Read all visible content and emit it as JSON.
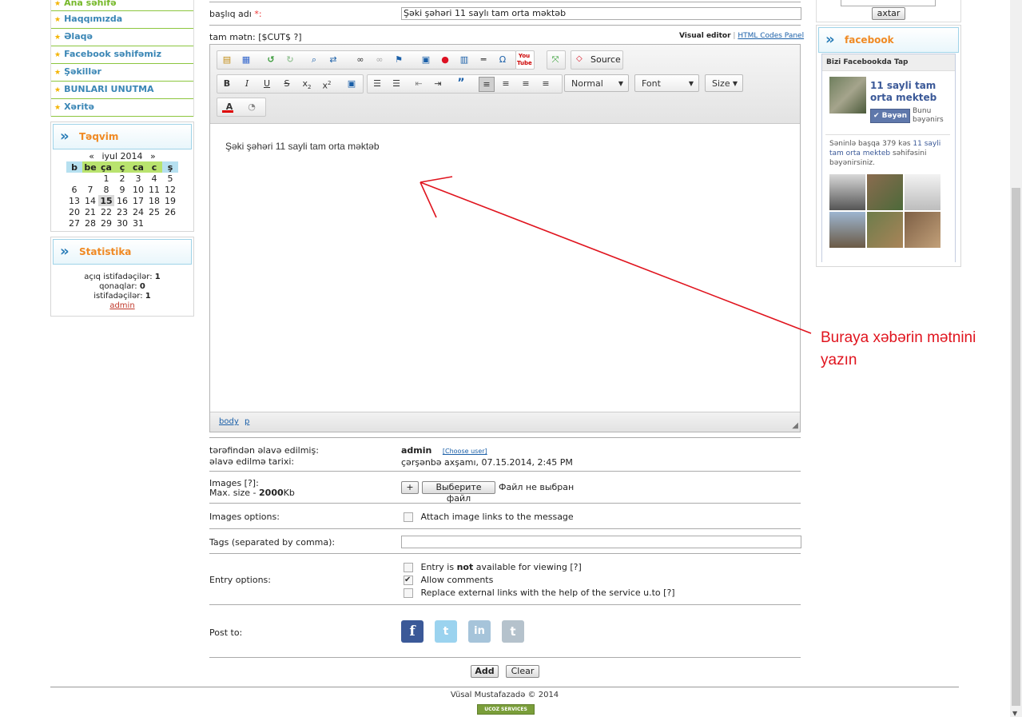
{
  "menu": {
    "items": [
      "Ana səhifə",
      "Haqqımızda",
      "Əlaqə",
      "Facebook səhifəmiz",
      "Şəkillər",
      "BUNLARI UNUTMA",
      "Xəritə"
    ]
  },
  "calendar": {
    "title": "Təqvim",
    "nav_prev": "«",
    "month": "iyul 2014",
    "nav_next": "»",
    "weekdays": [
      "b",
      "be",
      "ça",
      "ç",
      "ca",
      "c",
      "ş"
    ],
    "weeks": [
      [
        "",
        "",
        "1",
        "2",
        "3",
        "4",
        "5"
      ],
      [
        "6",
        "7",
        "8",
        "9",
        "10",
        "11",
        "12"
      ],
      [
        "13",
        "14",
        "15",
        "16",
        "17",
        "18",
        "19"
      ],
      [
        "20",
        "21",
        "22",
        "23",
        "24",
        "25",
        "26"
      ],
      [
        "27",
        "28",
        "29",
        "30",
        "31",
        "",
        ""
      ]
    ],
    "today": "15"
  },
  "stats": {
    "title": "Statistika",
    "online_label": "açıq istifadəçilər:",
    "online_value": "1",
    "guests_label": "qonaqlar:",
    "guests_value": "0",
    "users_label": "istifadəçilər:",
    "users_value": "1",
    "user_link": "admin"
  },
  "search": {
    "button": "axtar"
  },
  "form": {
    "title_label": "başlıq adı",
    "required_mark": "*:",
    "title_value": "Şəki şəhəri 11 saylı tam orta məktəb",
    "body_label": "tam mətn: [$CUT$ ?]",
    "visual_editor": "Visual editor",
    "separator": "|",
    "html_codes": "HTML Codes Panel",
    "editor_content": "Şəki şəhəri 11 sayli tam orta məktəb",
    "path_body": "body",
    "path_p": "p",
    "added_by_label": "tərəfindən əlavə edilmiş:",
    "added_by_value": "admin",
    "choose_user": "[Choose user]",
    "date_label": "əlavə edilmə tarixi:",
    "date_value": "çərşənbə axşamı, 07.15.2014, 2:45 PM",
    "images_label": "Images [?]:",
    "max_size_prefix": "Max. size - ",
    "max_size_value": "2000",
    "max_size_unit": "Kb",
    "plus": "+",
    "choose_file": "Выберите файл",
    "no_file": "Файл не выбран",
    "images_options_label": "Images options:",
    "attach_links": "Attach image links to the message",
    "tags_label": "Tags (separated by comma):",
    "entry_options_label": "Entry options:",
    "opt1_a": "Entry is",
    "opt1_b": "not",
    "opt1_c": "available for viewing [?]",
    "opt2": "Allow comments",
    "opt3": "Replace external links with the help of the service u.to [?]",
    "post_to_label": "Post to:",
    "add_button": "Add",
    "clear_button": "Clear"
  },
  "toolbar": {
    "source": "Source",
    "format": "Normal",
    "font": "Font",
    "size": "Size"
  },
  "annotation": {
    "line1": "Buraya xəbərin mətnini",
    "line2": "yazın",
    "color": "#e0141e"
  },
  "facebook": {
    "title": "facebook",
    "box_title": "Bizi Facebookda Tap",
    "page_name": "11 sayli tam orta mekteb",
    "like_button": "Bəyən",
    "like_text": "Bunu bəyənirs",
    "friends_text_a": "Səninlə başqa 379 kəs ",
    "friends_text_link": "11 sayli tam orta mekteb",
    "friends_text_b": " səhifəsini bəyənirsiniz."
  },
  "footer": {
    "copyright": "Vüsal Mustafazadə © 2014",
    "badge": "UCOZ SERVICES"
  },
  "colors": {
    "accent_orange": "#f08a24",
    "link_blue": "#3a86b5",
    "menu_green": "#8cc63f",
    "facebook_blue": "#3b5998"
  }
}
